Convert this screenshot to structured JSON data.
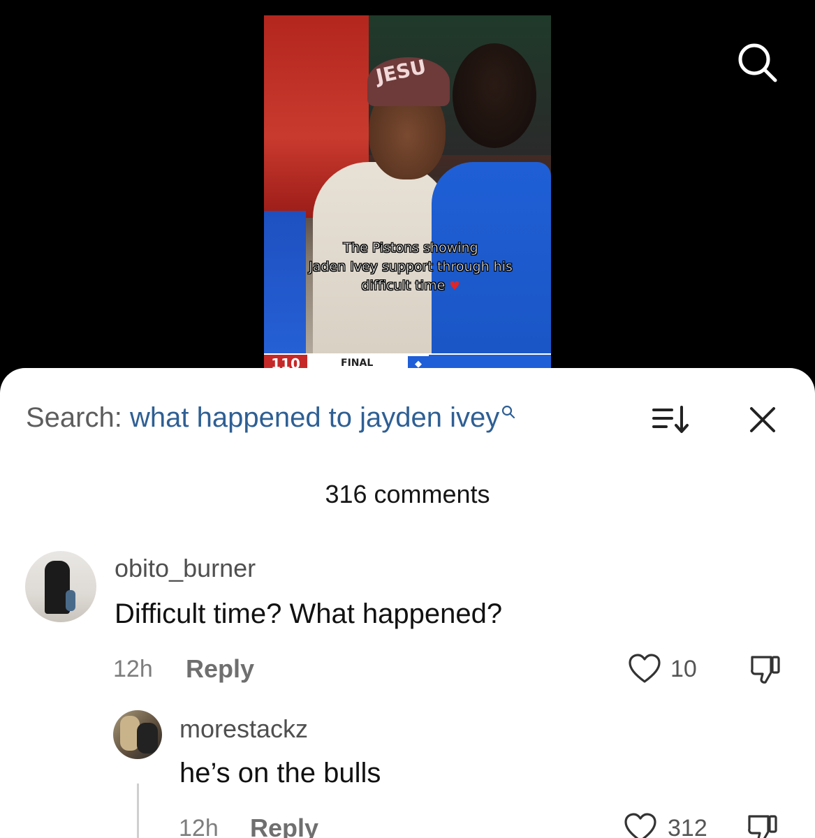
{
  "video": {
    "beanie_text": "JESU",
    "caption_line1": "The Pistons showing",
    "caption_line2": "Jaden Ivey support through his",
    "caption_line3": "difficult time",
    "caption_heart": "♥",
    "score": "110",
    "status": "FINAL"
  },
  "search": {
    "label": "Search:",
    "query": "what happened to jayden ivey"
  },
  "comments_count": "316 comments",
  "comments": [
    {
      "username": "obito_burner",
      "text": "Difficult time? What happened?",
      "time": "12h",
      "reply_label": "Reply",
      "likes": "10"
    },
    {
      "username": "morestackz",
      "text": "he’s on the bulls",
      "time": "12h",
      "reply_label": "Reply",
      "likes": "312"
    }
  ],
  "icons": {
    "top_right": "search-icon",
    "sort": "sort-icon",
    "close": "close-icon",
    "like": "heart-icon",
    "dislike": "thumbs-down-icon"
  },
  "colors": {
    "query_blue": "#2e5f94",
    "sheet_bg": "#ffffff",
    "page_bg": "#000000"
  }
}
